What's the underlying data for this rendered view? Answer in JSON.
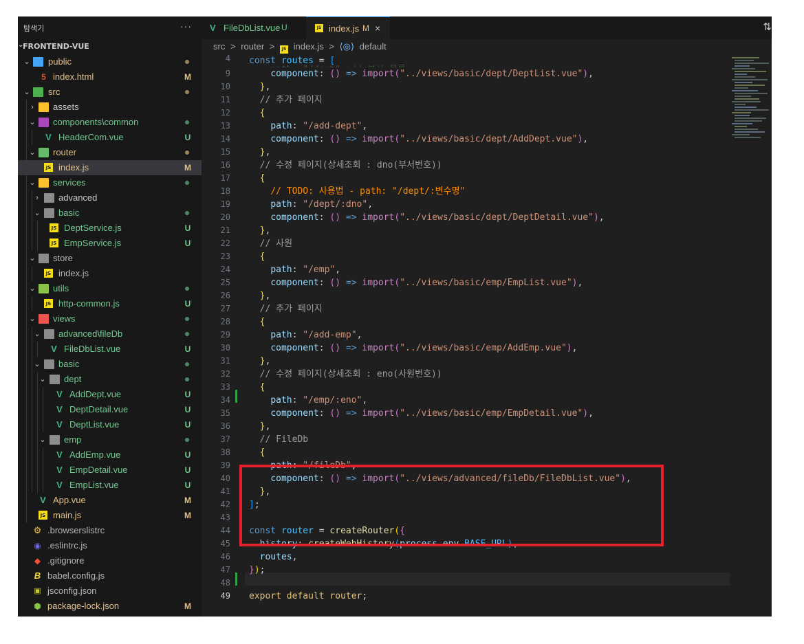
{
  "sidebar": {
    "title": "탐색기",
    "more": "···",
    "project": "FRONTEND-VUE",
    "items": [
      {
        "label": "public",
        "badge": "",
        "dot": "mod"
      },
      {
        "label": "index.html",
        "badge": "M",
        "dot": ""
      },
      {
        "label": "src",
        "badge": "",
        "dot": "mod"
      },
      {
        "label": "assets",
        "badge": "",
        "dot": ""
      },
      {
        "label": "components",
        "label_sep": "\\",
        "label_sub": "common",
        "badge": "",
        "dot": "unt"
      },
      {
        "label": "HeaderCom.vue",
        "badge": "U",
        "dot": ""
      },
      {
        "label": "router",
        "badge": "",
        "dot": "mod"
      },
      {
        "label": "index.js",
        "badge": "M",
        "dot": ""
      },
      {
        "label": "services",
        "badge": "",
        "dot": "unt"
      },
      {
        "label": "advanced",
        "badge": "",
        "dot": ""
      },
      {
        "label": "basic",
        "badge": "",
        "dot": "unt"
      },
      {
        "label": "DeptService.js",
        "badge": "U",
        "dot": ""
      },
      {
        "label": "EmpService.js",
        "badge": "U",
        "dot": ""
      },
      {
        "label": "store",
        "badge": "",
        "dot": ""
      },
      {
        "label": "index.js",
        "badge": "",
        "dot": ""
      },
      {
        "label": "utils",
        "badge": "",
        "dot": "unt"
      },
      {
        "label": "http-common.js",
        "badge": "U",
        "dot": ""
      },
      {
        "label": "views",
        "badge": "",
        "dot": "unt"
      },
      {
        "label": "advanced",
        "label_sep": "\\",
        "label_sub": "fileDb",
        "badge": "",
        "dot": "unt"
      },
      {
        "label": "FileDbList.vue",
        "badge": "U",
        "dot": ""
      },
      {
        "label": "basic",
        "badge": "",
        "dot": "unt"
      },
      {
        "label": "dept",
        "badge": "",
        "dot": "unt"
      },
      {
        "label": "AddDept.vue",
        "badge": "U",
        "dot": ""
      },
      {
        "label": "DeptDetail.vue",
        "badge": "U",
        "dot": ""
      },
      {
        "label": "DeptList.vue",
        "badge": "U",
        "dot": ""
      },
      {
        "label": "emp",
        "badge": "",
        "dot": "unt"
      },
      {
        "label": "AddEmp.vue",
        "badge": "U",
        "dot": ""
      },
      {
        "label": "EmpDetail.vue",
        "badge": "U",
        "dot": ""
      },
      {
        "label": "EmpList.vue",
        "badge": "U",
        "dot": ""
      },
      {
        "label": "App.vue",
        "badge": "M",
        "dot": ""
      },
      {
        "label": "main.js",
        "badge": "M",
        "dot": ""
      },
      {
        "label": ".browserslistrc",
        "badge": "",
        "dot": ""
      },
      {
        "label": ".eslintrc.js",
        "badge": "",
        "dot": ""
      },
      {
        "label": ".gitignore",
        "badge": "",
        "dot": ""
      },
      {
        "label": "babel.config.js",
        "badge": "",
        "dot": ""
      },
      {
        "label": "jsconfig.json",
        "badge": "",
        "dot": ""
      },
      {
        "label": "package-lock.json",
        "badge": "M",
        "dot": ""
      }
    ]
  },
  "tabs": [
    {
      "label": "FileDbList.vue",
      "status": "U",
      "icon": "vue-icon",
      "active": false
    },
    {
      "label": "index.js",
      "status": "M",
      "icon": "js-icon",
      "active": true,
      "close": "×"
    }
  ],
  "breadcrumb": {
    "items": [
      "src",
      "router",
      "index.js",
      "default"
    ],
    "sep": ">"
  },
  "editor": {
    "line_numbers": [
      "4",
      "9",
      "10",
      "11",
      "12",
      "13",
      "14",
      "15",
      "16",
      "17",
      "18",
      "19",
      "20",
      "21",
      "22",
      "23",
      "24",
      "25",
      "26",
      "27",
      "28",
      "29",
      "30",
      "31",
      "32",
      "33",
      "34",
      "35",
      "36",
      "37",
      "38",
      "39",
      "40",
      "41",
      "42",
      "43",
      "44",
      "45",
      "46",
      "47",
      "48",
      "49"
    ],
    "current_line": "49",
    "modified_lines": [
      "32",
      "49"
    ],
    "highlight": "FileDb route block (lines 36-41)"
  },
  "colors": {
    "accent": "#0078d4",
    "modified": "#e2c08d",
    "untracked": "#73c991",
    "highlight_box": "#e3202b"
  }
}
